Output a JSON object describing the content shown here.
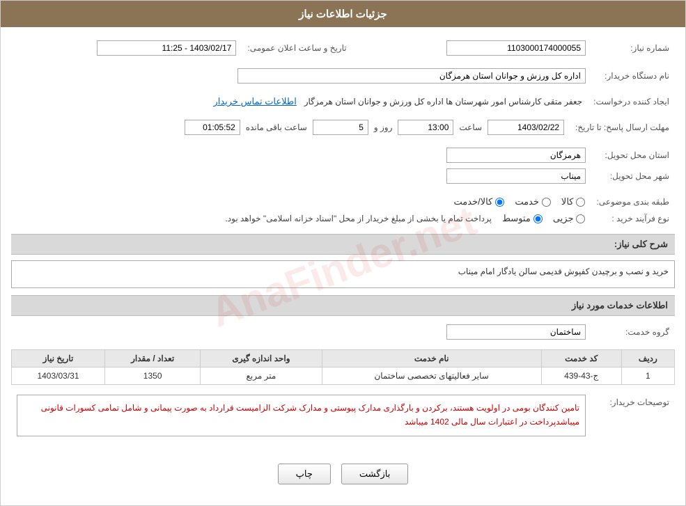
{
  "page": {
    "title": "جزئیات اطلاعات نیاز",
    "watermark": "AnaFinder.net"
  },
  "header": {
    "label_shomara": "شماره نیاز:",
    "shomara_value": "1103000174000055",
    "label_tarikh": "تاریخ و ساعت اعلان عمومی:",
    "tarikh_value": "1403/02/17 - 11:25",
    "label_nam_dastgah": "نام دستگاه خریدار:",
    "dastgah_value": "اداره کل ورزش و جوانان استان هرمزگان",
    "label_ijad": "ایجاد کننده درخواست:",
    "ijad_value": "جعفر متقی کارشناس امور شهرستان ها اداره کل ورزش و جوانان استان هرمزگار",
    "link_ettela": "اطلاعات تماس خریدار",
    "label_mohlat": "مهلت ارسال پاسخ: تا تاریخ:",
    "date_value": "1403/02/22",
    "label_saat": "ساعت",
    "saat_value": "13:00",
    "label_roz": "روز و",
    "roz_value": "5",
    "label_baqi": "ساعت باقی مانده",
    "baqi_value": "01:05:52",
    "label_ostan": "استان محل تحویل:",
    "ostan_value": "هرمزگان",
    "label_shahr": "شهر محل تحویل:",
    "shahr_value": "میناب",
    "label_tabaqe": "طبقه بندی موضوعی:",
    "radio_kala": "کالا",
    "radio_khedmat": "خدمت",
    "radio_kala_khedmat": "کالا/خدمت",
    "label_noʿ": "نوع فرآیند خرید :",
    "radio_jozvi": "جزیی",
    "radio_motovaset": "متوسط",
    "text_noʿ": "پرداخت تمام یا بخشی از مبلغ خریدار از محل \"اسناد خزانه اسلامی\" خواهد بود."
  },
  "sharh": {
    "section_title": "شرح کلی نیاز:",
    "value": "خرید و نصب و برچیدن کفپوش قدیمی سالن یادگار امام میناب"
  },
  "khadamat": {
    "section_title": "اطلاعات خدمات مورد نیاز",
    "label_group": "گروه خدمت:",
    "group_value": "ساختمان"
  },
  "table": {
    "headers": [
      "ردیف",
      "کد خدمت",
      "نام خدمت",
      "واحد اندازه گیری",
      "تعداد / مقدار",
      "تاریخ نیاز"
    ],
    "rows": [
      {
        "radif": "1",
        "kod": "ج-43-439",
        "nam": "سایر فعالیتهای تخصصی ساختمان",
        "vahed": "متر مربع",
        "tedad": "1350",
        "tarikh": "1403/03/31"
      }
    ]
  },
  "tawzih": {
    "section_title": "توصیحات خریدار:",
    "value": "تامین کنندگان بومی در اولویت هستند، برکردن و بارگذاری مدارک پیوستی  و  مدارک شرکت الزامیست   قرارداد به صورت پیمانی و شامل تمامی کسورات قانونی میباشدپرداخت در اعتبارات سال مالی 1402 میباشد"
  },
  "buttons": {
    "print": "چاپ",
    "back": "بازگشت"
  }
}
